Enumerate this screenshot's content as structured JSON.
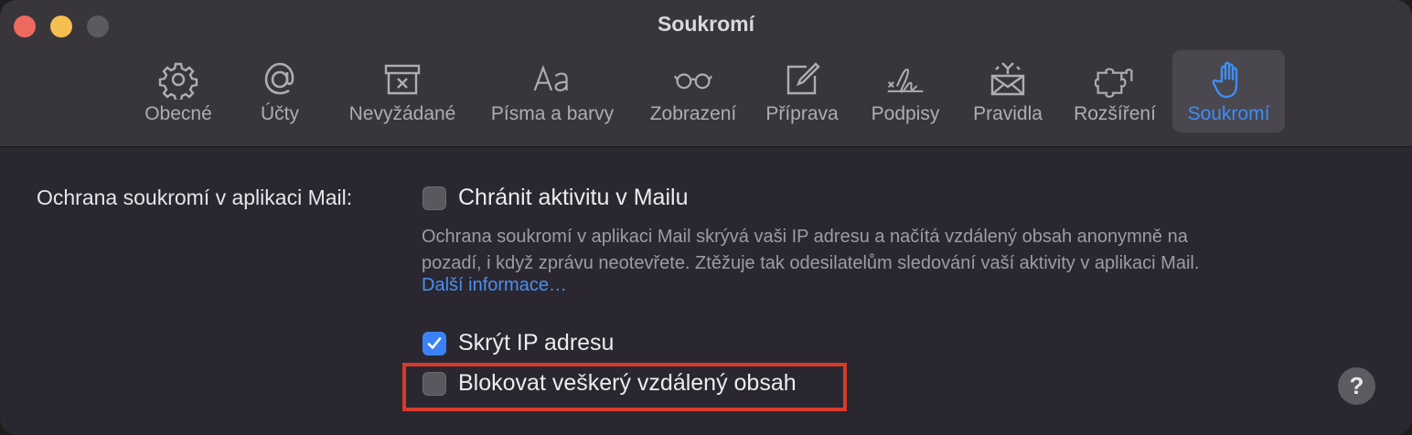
{
  "window": {
    "title": "Soukromí"
  },
  "toolbar": {
    "tabs": [
      {
        "label": "Obecné",
        "icon": "gear-icon"
      },
      {
        "label": "Účty",
        "icon": "at-sign-icon"
      },
      {
        "label": "Nevyžádané",
        "icon": "junk-tray-icon"
      },
      {
        "label": "Písma a barvy",
        "icon": "font-aa-icon"
      },
      {
        "label": "Zobrazení",
        "icon": "glasses-icon"
      },
      {
        "label": "Příprava",
        "icon": "compose-icon"
      },
      {
        "label": "Podpisy",
        "icon": "signature-icon"
      },
      {
        "label": "Pravidla",
        "icon": "rules-envelope-icon"
      },
      {
        "label": "Rozšíření",
        "icon": "puzzle-icon"
      },
      {
        "label": "Soukromí",
        "icon": "hand-icon",
        "active": true
      }
    ]
  },
  "privacy": {
    "section_label": "Ochrana soukromí v aplikaci Mail:",
    "protect_label": "Chránit aktivitu v Mailu",
    "protect_checked": false,
    "description_line1": "Ochrana soukromí v aplikaci Mail skrývá vaši IP adresu a načítá vzdálený obsah anonymně na",
    "description_line2": "pozadí, i když zprávu neotevřete. Ztěžuje tak odesilatelům sledování vaší aktivity v aplikaci Mail.",
    "more_info_link": "Další informace…",
    "hide_ip_label": "Skrýt IP adresu",
    "hide_ip_checked": true,
    "block_remote_label": "Blokovat veškerý vzdálený obsah",
    "block_remote_checked": false
  },
  "help": {
    "label": "?"
  },
  "colors": {
    "accent": "#3d8ef8",
    "highlight": "#d83b2a",
    "checkbox_checked": "#3b82f6"
  }
}
